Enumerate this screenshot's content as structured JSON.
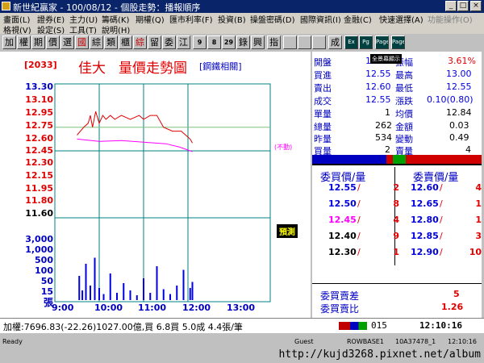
{
  "window": {
    "title": "新世紀贏家 - 100/08/12 - 個股走勢：播報順序",
    "min": "_",
    "max": "□",
    "close": "×"
  },
  "menubar_row1": [
    {
      "label": "畫面(L)",
      "enabled": true
    },
    {
      "label": "證券(E)",
      "enabled": true
    },
    {
      "label": "主力(U)",
      "enabled": true
    },
    {
      "label": "籌碼(K)",
      "enabled": true
    },
    {
      "label": "期權(Q)",
      "enabled": true
    },
    {
      "label": "匯市利率(F)",
      "enabled": true
    },
    {
      "label": "投資(B)",
      "enabled": true
    },
    {
      "label": "操盤密碼(D)",
      "enabled": true
    },
    {
      "label": "國際資訊(I)",
      "enabled": true
    },
    {
      "label": "金融(C)",
      "enabled": true
    },
    {
      "label": "快速選擇(A)",
      "enabled": true
    },
    {
      "label": "功能操作(O)",
      "enabled": false
    }
  ],
  "menubar_row2": [
    {
      "label": "格視(V)"
    },
    {
      "label": "設定(S)"
    },
    {
      "label": "工具(T)"
    },
    {
      "label": "說明(H)"
    }
  ],
  "toolbar": [
    "加",
    "權",
    "期",
    "價",
    "選",
    "國",
    "綜",
    "類",
    "櫃",
    "綜",
    "留",
    "委",
    "江",
    "9",
    "8",
    "29",
    "錄",
    "興",
    "指",
    "",
    "",
    "",
    "成",
    "Ex",
    "Pg",
    "Page",
    "Page"
  ],
  "stock": {
    "code": "[2033]",
    "name": "佳大",
    "chart_title": "量價走勢圖",
    "category": "[鋼鐵相關]",
    "ref_label": "(不動)",
    "predict": "預測"
  },
  "quote": {
    "open_label": "開盤",
    "open": "12.55",
    "bid_label": "買進",
    "bid": "12.55",
    "ask_label": "賣出",
    "ask": "12.60",
    "last_label": "成交",
    "last": "12.55",
    "unit_label": "單量",
    "unit": "1",
    "total_label": "總量",
    "total": "262",
    "yest_label": "昨量",
    "yest": "534",
    "buyvol_label": "買量",
    "buyvol": "2",
    "range_label": "振幅",
    "range": "3.61%",
    "high_label": "最高",
    "high": "13.00",
    "low_label": "最低",
    "low": "12.55",
    "chg_label": "漲跌",
    "chg": "0.10(0.80)",
    "avg_label": "均價",
    "avg": "12.84",
    "amount_label": "金額",
    "amount": "0.03",
    "change_label": "變動",
    "change": "0.49",
    "sellvol_label": "賣量",
    "sellvol": "4",
    "tooltip": "全景幕顯示"
  },
  "orderbook": {
    "bid_header": "委買價/量",
    "ask_header": "委賣價/量",
    "bids": [
      {
        "price": "12.55",
        "qty": "2",
        "color": "#0000e0"
      },
      {
        "price": "12.50",
        "qty": "8",
        "color": "#0000e0"
      },
      {
        "price": "12.45",
        "qty": "4",
        "color": "#ff00ff"
      },
      {
        "price": "12.40",
        "qty": "9",
        "color": "#000000"
      },
      {
        "price": "12.30",
        "qty": "1",
        "color": "#000000"
      }
    ],
    "asks": [
      {
        "price": "12.60",
        "qty": "4",
        "color": "#0000e0"
      },
      {
        "price": "12.65",
        "qty": "1",
        "color": "#0000e0"
      },
      {
        "price": "12.80",
        "qty": "1",
        "color": "#0000e0"
      },
      {
        "price": "12.85",
        "qty": "3",
        "color": "#0000e0"
      },
      {
        "price": "12.90",
        "qty": "10",
        "color": "#0000e0"
      }
    ],
    "diff_label": "委買賣差",
    "diff": "5",
    "ratio_label": "委買賣比",
    "ratio": "1.26"
  },
  "chart_data": {
    "type": "line",
    "y_ticks": [
      "13.30",
      "13.10",
      "12.95",
      "12.75",
      "12.60",
      "12.45",
      "12.30",
      "12.15",
      "11.95",
      "11.80",
      "11.60"
    ],
    "y_tick_colors": [
      "#0000c0",
      "#e00000",
      "#e00000",
      "#e00000",
      "#e00000",
      "#e00000",
      "#e00000",
      "#e00000",
      "#e00000",
      "#e00000",
      "#000000"
    ],
    "vol_ticks": [
      "3,000",
      "1,000",
      "500",
      "100",
      "50",
      "15"
    ],
    "vol_unit": "張",
    "x_ticks": [
      "9:00",
      "10:00",
      "11:00",
      "12:00",
      "13:00"
    ],
    "ylim": [
      11.6,
      13.3
    ],
    "series": [
      {
        "color": "#e00000",
        "points": [
          [
            9.5,
            12.65
          ],
          [
            9.65,
            12.75
          ],
          [
            9.75,
            12.8
          ],
          [
            9.8,
            12.9
          ],
          [
            9.85,
            12.75
          ],
          [
            9.92,
            12.95
          ],
          [
            10.0,
            12.8
          ],
          [
            10.08,
            12.9
          ],
          [
            10.15,
            12.85
          ],
          [
            10.25,
            12.9
          ],
          [
            10.35,
            12.85
          ],
          [
            10.5,
            12.9
          ],
          [
            10.7,
            12.85
          ],
          [
            10.9,
            12.9
          ],
          [
            11.0,
            12.85
          ],
          [
            11.15,
            12.9
          ],
          [
            11.3,
            12.9
          ],
          [
            11.45,
            12.75
          ],
          [
            11.65,
            12.7
          ],
          [
            11.85,
            12.7
          ],
          [
            11.95,
            12.65
          ],
          [
            12.05,
            12.6
          ],
          [
            12.1,
            12.55
          ]
        ]
      },
      {
        "color": "#ff00ff",
        "points": [
          [
            9.5,
            12.6
          ],
          [
            10.0,
            12.57
          ],
          [
            10.5,
            12.58
          ],
          [
            11.0,
            12.56
          ],
          [
            11.5,
            12.54
          ],
          [
            11.8,
            12.5
          ],
          [
            11.95,
            12.47
          ],
          [
            12.05,
            12.45
          ],
          [
            12.1,
            12.44
          ]
        ]
      }
    ],
    "ref_price": 12.45,
    "volume_bars": [
      {
        "t": 9.55,
        "v": 20
      },
      {
        "t": 9.62,
        "v": 8
      },
      {
        "t": 9.7,
        "v": 30
      },
      {
        "t": 9.8,
        "v": 12
      },
      {
        "t": 9.9,
        "v": 35
      },
      {
        "t": 10.0,
        "v": 10
      },
      {
        "t": 10.1,
        "v": 5
      },
      {
        "t": 10.25,
        "v": 22
      },
      {
        "t": 10.4,
        "v": 6
      },
      {
        "t": 10.55,
        "v": 14
      },
      {
        "t": 10.7,
        "v": 8
      },
      {
        "t": 10.85,
        "v": 4
      },
      {
        "t": 11.0,
        "v": 18
      },
      {
        "t": 11.15,
        "v": 6
      },
      {
        "t": 11.3,
        "v": 28
      },
      {
        "t": 11.45,
        "v": 9
      },
      {
        "t": 11.6,
        "v": 5
      },
      {
        "t": 11.75,
        "v": 12
      },
      {
        "t": 11.9,
        "v": 25
      },
      {
        "t": 12.05,
        "v": 10
      },
      {
        "t": 12.1,
        "v": 15
      }
    ]
  },
  "statusline": {
    "text": "加權:7696.83(-22.26)1027.00億,買 6.8買 5.0成 4.4張/筆",
    "page": "015",
    "time": "12:10:16"
  },
  "statusbar": {
    "ready": "Ready",
    "user": "Guest",
    "row": "ROWBASE1",
    "session": "10A37478_1",
    "time": "12:10:16"
  },
  "watermark": "http://kujd3268.pixnet.net/album"
}
